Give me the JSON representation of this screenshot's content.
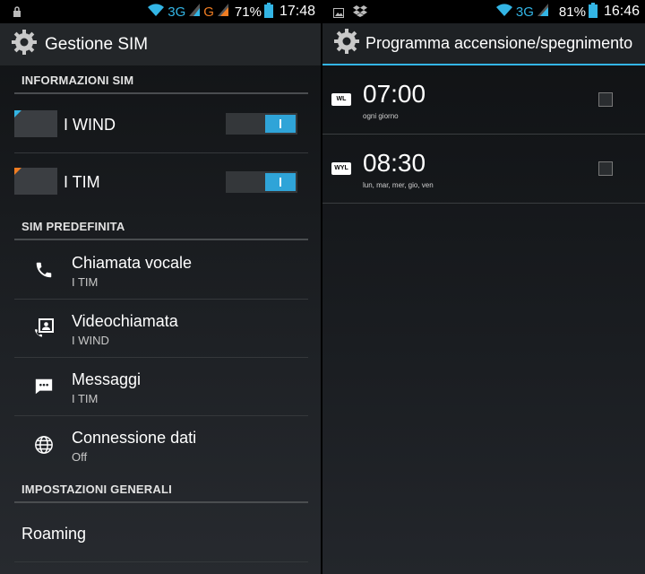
{
  "left": {
    "status": {
      "network": "3G",
      "network2": "G",
      "battery": "71%",
      "time": "17:48"
    },
    "title": "Gestione SIM",
    "sections": {
      "info": "INFORMAZIONI SIM",
      "default": "SIM PREDEFINITA",
      "general": "IMPOSTAZIONI GENERALI"
    },
    "sims": [
      {
        "label": "I WIND",
        "corner_color": "#33b5e5",
        "enabled": true
      },
      {
        "label": "I TIM",
        "corner_color": "#f07d22",
        "enabled": true
      }
    ],
    "prefs": [
      {
        "title": "Chiamata vocale",
        "value": "I TIM",
        "icon": "phone-icon"
      },
      {
        "title": "Videochiamata",
        "value": "I WIND",
        "icon": "video-call-icon"
      },
      {
        "title": "Messaggi",
        "value": "I TIM",
        "icon": "message-icon"
      },
      {
        "title": "Connessione dati",
        "value": "Off",
        "icon": "globe-icon"
      }
    ],
    "roaming": "Roaming"
  },
  "right": {
    "status": {
      "network": "3G",
      "battery": "81%",
      "time": "16:46"
    },
    "title": "Programma accensione/spegnimento",
    "alarms": [
      {
        "badge": "WL",
        "time": "07:00",
        "days": "ogni giorno",
        "checked": false
      },
      {
        "badge": "WYL",
        "time": "08:30",
        "days": "lun, mar, mer, gio, ven",
        "checked": false
      }
    ]
  },
  "colors": {
    "accent": "#33b5e5",
    "orange": "#f07d22"
  }
}
